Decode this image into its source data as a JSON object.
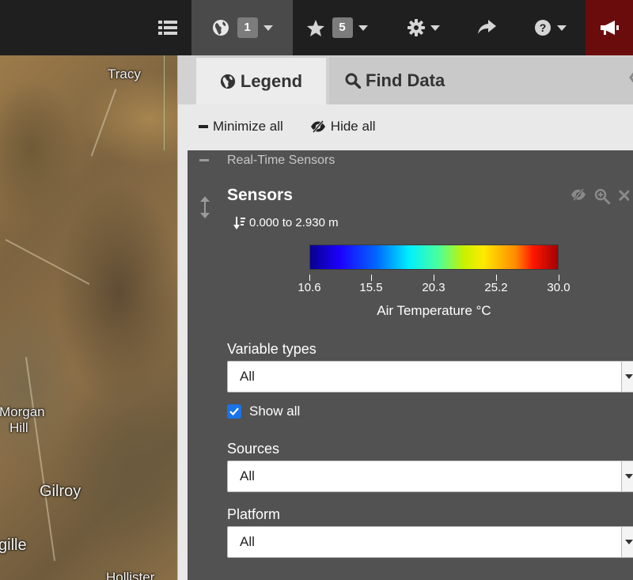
{
  "toolbar": {
    "layers_count": "1",
    "favorites_count": "5",
    "colors": {
      "bar": "#1f1f1f",
      "active": "#4a4a4a",
      "alert": "#6b0c0c"
    }
  },
  "map": {
    "places": [
      "Tracy",
      "Morgan",
      "Hill",
      "Gilroy",
      "gille",
      "Hollister"
    ]
  },
  "panel": {
    "tabs": {
      "legend": "Legend",
      "find": "Find Data"
    },
    "actions": {
      "minimize": "Minimize all",
      "hide": "Hide all"
    },
    "group": {
      "name": "Real-Time Sensors"
    },
    "layer": {
      "title": "Sensors",
      "depth": "0.000 to 2.930 m",
      "colorbar": {
        "ticks": [
          "10.6",
          "15.5",
          "20.3",
          "25.2",
          "30.0"
        ],
        "title": "Air Temperature °C"
      },
      "variable_types": {
        "label": "Variable types",
        "value": "All"
      },
      "show_all": {
        "label": "Show all",
        "checked": true
      },
      "sources": {
        "label": "Sources",
        "value": "All"
      },
      "platform": {
        "label": "Platform",
        "value": "All"
      }
    }
  }
}
